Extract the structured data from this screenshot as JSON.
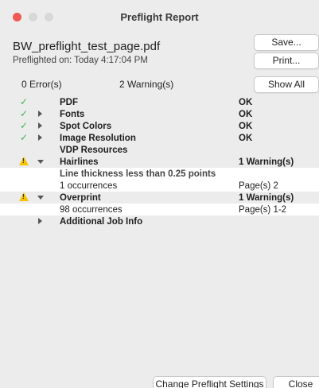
{
  "window": {
    "title": "Preflight Report"
  },
  "header": {
    "filename": "BW_preflight_test_page.pdf",
    "preflighted": "Preflighted on: Today 4:17:04 PM",
    "save_label": "Save...",
    "print_label": "Print...",
    "errors": "0 Error(s)",
    "warnings": "2 Warning(s)",
    "show_all_label": "Show All"
  },
  "report": {
    "rows": [
      {
        "label": "PDF",
        "result": "OK"
      },
      {
        "label": "Fonts",
        "result": "OK"
      },
      {
        "label": "Spot Colors",
        "result": "OK"
      },
      {
        "label": "Image Resolution",
        "result": "OK"
      },
      {
        "label": "VDP Resources",
        "result": ""
      },
      {
        "label": "Hairlines",
        "result": "1 Warning(s)"
      },
      {
        "label": "Line thickness less than 0.25 points",
        "result": ""
      },
      {
        "label": "1 occurrences",
        "result": "Page(s) 2"
      },
      {
        "label": "Overprint",
        "result": "1 Warning(s)"
      },
      {
        "label": "98 occurrences",
        "result": "Page(s) 1-2"
      },
      {
        "label": "Additional Job Info",
        "result": ""
      }
    ]
  },
  "footer": {
    "change_settings_label": "Change Preflight Settings",
    "close_label": "Close"
  }
}
